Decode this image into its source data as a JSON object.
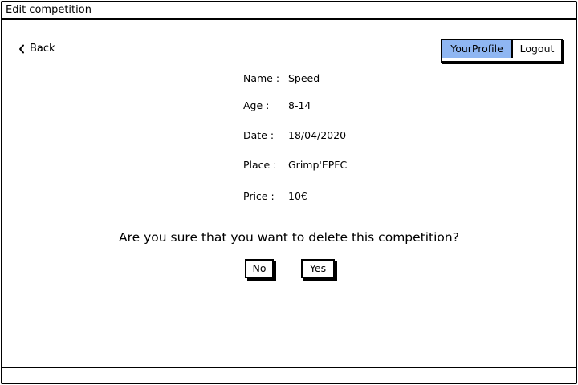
{
  "window": {
    "title": "Edit competition"
  },
  "nav": {
    "back_label": "Back",
    "profile_label": "YourProfile",
    "logout_label": "Logout",
    "active_color": "#8fb6f2"
  },
  "details": [
    {
      "label": "Name :",
      "value": "Speed"
    },
    {
      "label": "Age :",
      "value": "8-14"
    },
    {
      "label": "Date :",
      "value": "18/04/2020"
    },
    {
      "label": "Place :",
      "value": "Grimp'EPFC"
    },
    {
      "label": "Price :",
      "value": "10€"
    }
  ],
  "confirm": {
    "question": "Are you sure that you want to delete this competition?",
    "no_label": "No",
    "yes_label": "Yes"
  },
  "icons": {
    "back": "chevron-left-icon"
  }
}
